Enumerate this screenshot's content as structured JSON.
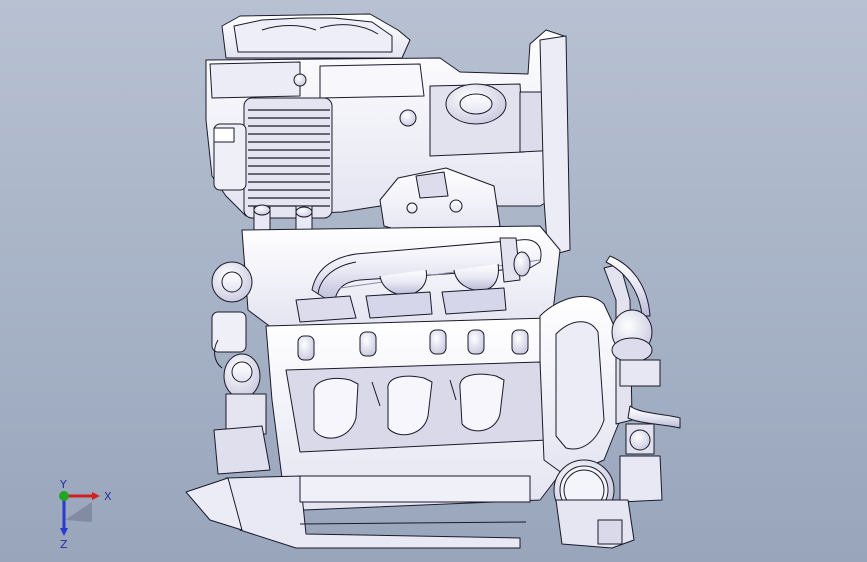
{
  "viewport": {
    "background_top": "#b7c1d2",
    "background_bottom": "#98a5bb"
  },
  "model": {
    "line_color": "#1a1a2a",
    "face_color": "#f4f4fb",
    "shade_color": "#d9d9ea",
    "accent_shade": "#c4c4de"
  },
  "triad": {
    "x_label": "X",
    "y_label": "Y",
    "z_label": "Z",
    "x_color": "#d21f1f",
    "y_color": "#24a424",
    "z_color": "#2a3ad0"
  }
}
